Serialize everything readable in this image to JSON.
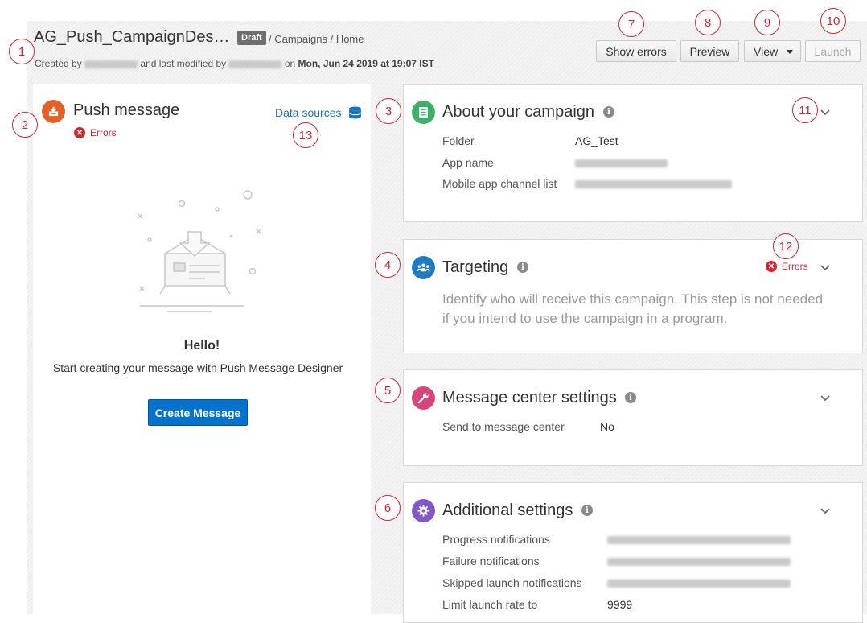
{
  "header": {
    "title": "AG_Push_CampaignDes…",
    "status_badge": "Draft",
    "breadcrumb": "/ Campaigns / Home",
    "created_prefix": "Created by",
    "modified_text": "and last modified by",
    "on_text": "on",
    "modified_date": "Mon, Jun 24 2019 at 19:07 IST"
  },
  "toolbar": {
    "show_errors": "Show errors",
    "preview": "Preview",
    "view": "View",
    "launch": "Launch"
  },
  "push_message": {
    "title": "Push message",
    "errors_label": "Errors",
    "data_sources": "Data sources",
    "hello": "Hello!",
    "start_text": "Start creating your message with Push Message Designer",
    "create_button": "Create Message"
  },
  "about": {
    "title": "About your campaign",
    "folder_label": "Folder",
    "folder_value": "AG_Test",
    "app_name_label": "App name",
    "channel_label": "Mobile app channel list"
  },
  "targeting": {
    "title": "Targeting",
    "errors_label": "Errors",
    "description": "Identify who will receive this campaign. This step is not needed if you intend to use the campaign in a program."
  },
  "message_center": {
    "title": "Message center settings",
    "send_label": "Send to message center",
    "send_value": "No"
  },
  "additional": {
    "title": "Additional settings",
    "progress_label": "Progress notifications",
    "failure_label": "Failure notifications",
    "skipped_label": "Skipped launch notifications",
    "limit_label": "Limit launch rate to",
    "limit_value": "9999"
  },
  "annotations": [
    "1",
    "2",
    "3",
    "4",
    "5",
    "6",
    "7",
    "8",
    "9",
    "10",
    "11",
    "12",
    "13"
  ],
  "colors": {
    "accent_blue": "#0572ce",
    "error_red": "#d9232e",
    "push_orange": "#e0622a",
    "about_green": "#3fae69",
    "targeting_blue": "#1f7ac2",
    "message_pink": "#d6457b",
    "additional_purple": "#8158c8"
  }
}
